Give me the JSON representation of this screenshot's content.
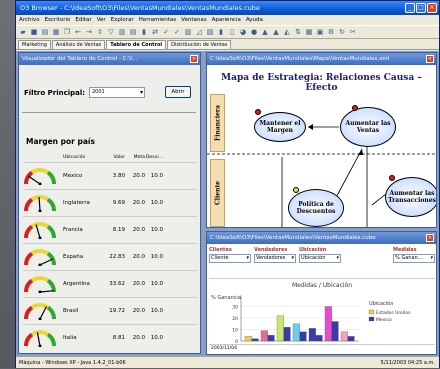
{
  "app": {
    "title": "O3 Browser - C:\\IdeaSoft\\O3\\Files\\VentasMundiales\\VentasMundiales.cube",
    "menu": [
      "Archivo",
      "Escritorio",
      "Editar",
      "Ver",
      "Explorar",
      "Herramientas",
      "Ventanas",
      "Apariencia",
      "Ayuda"
    ],
    "tabs": [
      "Marketing",
      "Análisis de Ventas",
      "Tablero de Control",
      "Distribución de Ventas"
    ],
    "active_tab": 2,
    "status": "Máquina - Windows XP - Java 1.4.2_01-b06",
    "status_date": "5/11/2003",
    "status_time": "04:25 a.m."
  },
  "dashboard": {
    "title": "Visualizador del Tablero de Control - C:\\I...",
    "filter_label": "Filtro Principal:",
    "filter_value": "2001",
    "open_button": "Abrir",
    "section_title": "Margen por país",
    "headers": [
      "Ubicación",
      "Valor",
      "Meta",
      "Desvi..."
    ],
    "rows": [
      {
        "country": "Mexico",
        "value": "3.80",
        "goal": "20.0",
        "dev": "10.0",
        "level": 0.19
      },
      {
        "country": "Inglaterra",
        "value": "9.69",
        "goal": "20.0",
        "dev": "10.0",
        "level": 0.48
      },
      {
        "country": "Francia",
        "value": "8.19",
        "goal": "20.0",
        "dev": "10.0",
        "level": 0.41
      },
      {
        "country": "España",
        "value": "22.83",
        "goal": "20.0",
        "dev": "10.0",
        "level": 0.86
      },
      {
        "country": "Argentina",
        "value": "33.62",
        "goal": "20.0",
        "dev": "10.0",
        "level": 0.97
      },
      {
        "country": "Brasil",
        "value": "19.72",
        "goal": "20.0",
        "dev": "10.0",
        "level": 0.65
      },
      {
        "country": "Italia",
        "value": "8.81",
        "goal": "20.0",
        "dev": "10.0",
        "level": 0.44
      }
    ]
  },
  "strategy": {
    "window_title": "C:\\IdeaSoft\\O3\\Files\\VentasMundiales\\Mapa\\VentasMundiales.xml",
    "title": "Mapa de Estrategia: Relaciones Causa – Efecto",
    "lanes": [
      "Financiera",
      "Cliente"
    ],
    "objectives": [
      "Mantener el Margen",
      "Aumentar las Ventas",
      "Política de Descuentos",
      "Aumentar las Transacciones"
    ]
  },
  "cube": {
    "window_title": "C:\\IdeaSoft\\O3\\Files\\VentasMundiales\\VentasMundiales.cube",
    "dimensions": [
      {
        "label": "Clientes",
        "value": "Cliente"
      },
      {
        "label": "Vendedores",
        "value": "Vendedores"
      },
      {
        "label": "Ubicación",
        "value": "Ubicación"
      }
    ],
    "measure": {
      "label": "Medidas",
      "value": "% Ganan..."
    },
    "footer": "2003/11/04"
  },
  "chart_data": {
    "type": "bar",
    "title": "Medidas / Ubicación",
    "ylabel": "% Ganancia",
    "ylim": [
      0,
      40
    ],
    "yticks": [
      0,
      10,
      20,
      30
    ],
    "legend_title": "Ubicación",
    "series": [
      {
        "name": "Estados Unidos",
        "color": "#e8d24a",
        "values": [
          4,
          9,
          22,
          15,
          11,
          30,
          8
        ]
      },
      {
        "name": "Mexico",
        "color": "#3a3aa8",
        "values": [
          2,
          5,
          12,
          8,
          5,
          17,
          4
        ]
      }
    ],
    "bar_colors": [
      "#e8d24a",
      "#e86a9a",
      "#c9e86a",
      "#6ad0e8",
      "#3a3aa8",
      "#e84ad0",
      "#f4a0c0"
    ]
  }
}
